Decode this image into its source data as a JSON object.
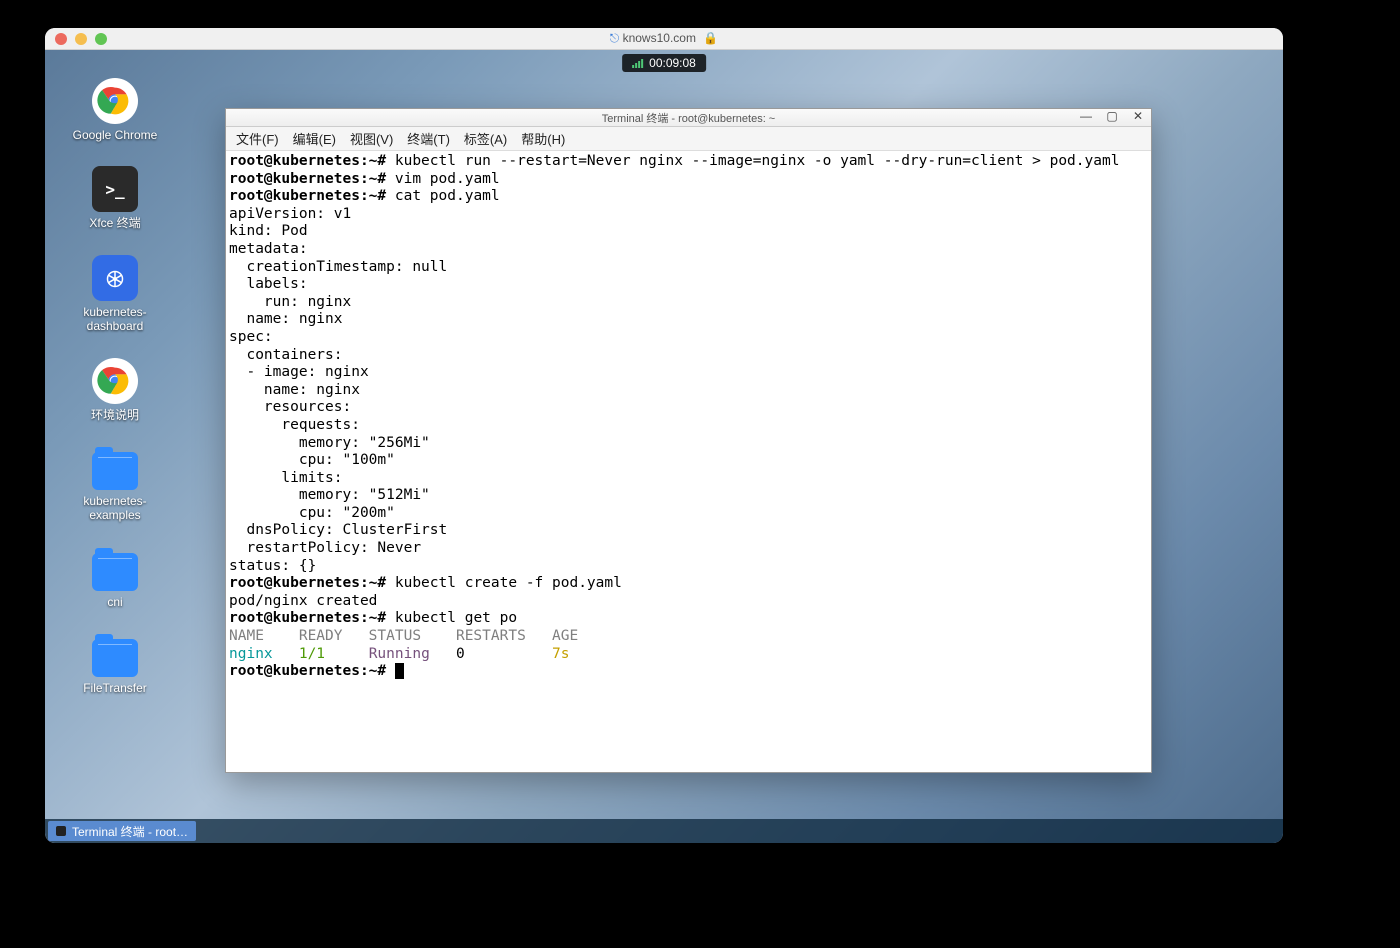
{
  "mac": {
    "url": "knows10.com"
  },
  "timer": "00:09:08",
  "desktop_icons": [
    {
      "kind": "chrome",
      "label": "Google Chrome"
    },
    {
      "kind": "term",
      "label": "Xfce 终端"
    },
    {
      "kind": "k8s",
      "label": "kubernetes-dashboard"
    },
    {
      "kind": "chrome",
      "label": "环境说明"
    },
    {
      "kind": "folder",
      "label": "kubernetes-examples"
    },
    {
      "kind": "folder",
      "label": "cni"
    },
    {
      "kind": "folder",
      "label": "FileTransfer"
    }
  ],
  "term": {
    "title": "Terminal 终端 - root@kubernetes: ~",
    "menu": [
      "文件(F)",
      "编辑(E)",
      "视图(V)",
      "终端(T)",
      "标签(A)",
      "帮助(H)"
    ],
    "prompt": "root@kubernetes:~#",
    "cmd1": "kubectl run --restart=Never nginx --image=nginx -o yaml --dry-run=client > pod.yaml",
    "cmd2": "vim pod.yaml",
    "cmd3": "cat pod.yaml",
    "yaml": "apiVersion: v1\nkind: Pod\nmetadata:\n  creationTimestamp: null\n  labels:\n    run: nginx\n  name: nginx\nspec:\n  containers:\n  - image: nginx\n    name: nginx\n    resources:\n      requests:\n        memory: \"256Mi\"\n        cpu: \"100m\"\n      limits:\n        memory: \"512Mi\"\n        cpu: \"200m\"\n  dnsPolicy: ClusterFirst\n  restartPolicy: Never\nstatus: {}",
    "cmd4": "kubectl create -f pod.yaml",
    "out4": "pod/nginx created",
    "cmd5": "kubectl get po",
    "table": {
      "headers": [
        "NAME",
        "READY",
        "STATUS",
        "RESTARTS",
        "AGE"
      ],
      "row": {
        "name": "nginx",
        "ready": "1/1",
        "status": "Running",
        "restarts": "0",
        "age": "7s"
      }
    }
  },
  "taskbar": {
    "item": "Terminal 终端 - root…"
  }
}
